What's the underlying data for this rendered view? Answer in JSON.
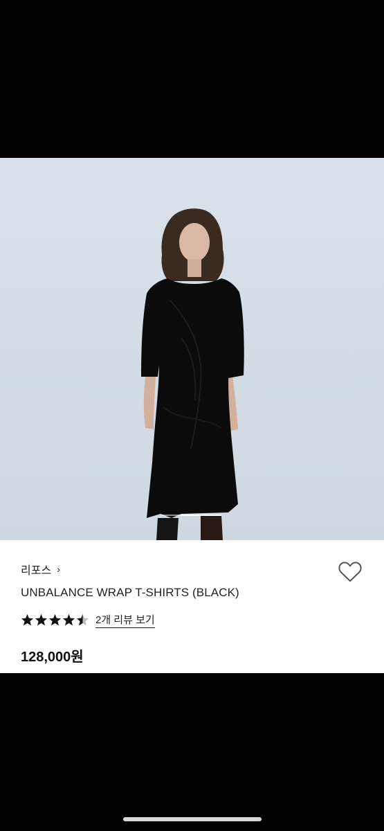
{
  "product": {
    "brand": "리포스",
    "brand_chevron": "›",
    "name": "UNBALANCE WRAP T-SHIRTS (BLACK)",
    "rating": 4.5,
    "review_link": "2개 리뷰 보기",
    "price": "128,000원"
  },
  "icons": {
    "wishlist": "heart-outline-icon",
    "star": "star-icon",
    "star_half": "star-half-icon"
  },
  "carousel": {
    "position": 0.33
  },
  "colors": {
    "background": "#000000",
    "photo_bg": "#d6dee7",
    "panel": "#ffffff",
    "text": "#222222",
    "garment": "#0b0b0b"
  }
}
